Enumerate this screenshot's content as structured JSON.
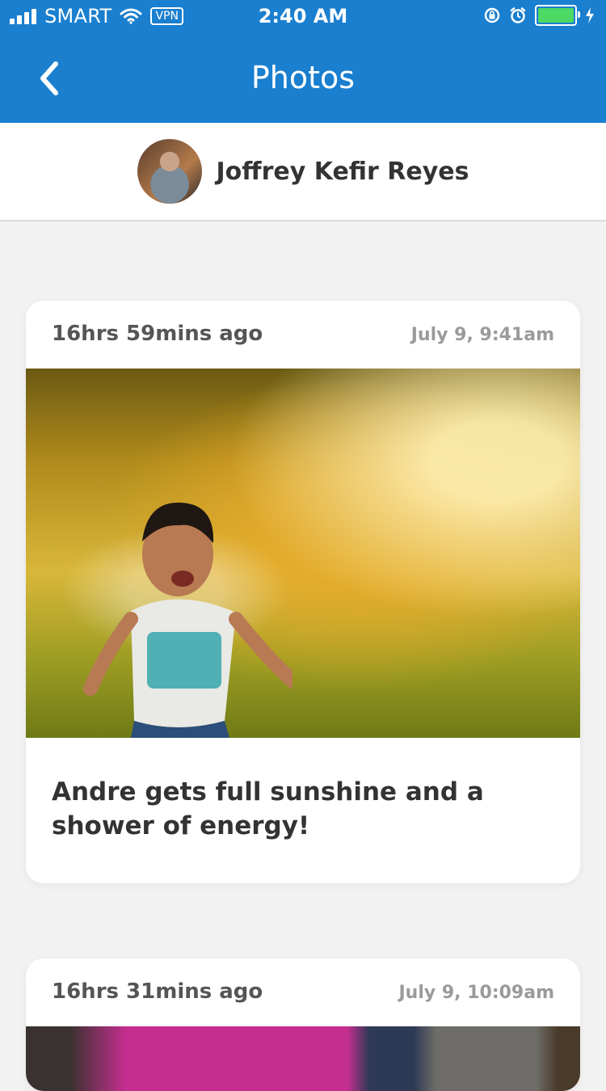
{
  "status_bar": {
    "carrier": "SMART",
    "vpn": "VPN",
    "time": "2:40 AM",
    "icons": [
      "signal-icon",
      "wifi-icon",
      "vpn-badge",
      "rotation-lock-icon",
      "alarm-icon",
      "battery-icon",
      "charging-bolt-icon"
    ]
  },
  "nav": {
    "back_icon": "chevron-left-icon",
    "title": "Photos"
  },
  "profile": {
    "name": "Joffrey Kefir Reyes"
  },
  "posts": [
    {
      "relative_time": "16hrs 59mins ago",
      "date": "July 9, 9:41am",
      "caption": "Andre gets full sunshine and a shower of energy!"
    },
    {
      "relative_time": "16hrs 31mins ago",
      "date": "July 9, 10:09am"
    }
  ],
  "colors": {
    "header": "#1a7fcf",
    "background": "#f2f2f2",
    "battery": "#4cd964"
  }
}
